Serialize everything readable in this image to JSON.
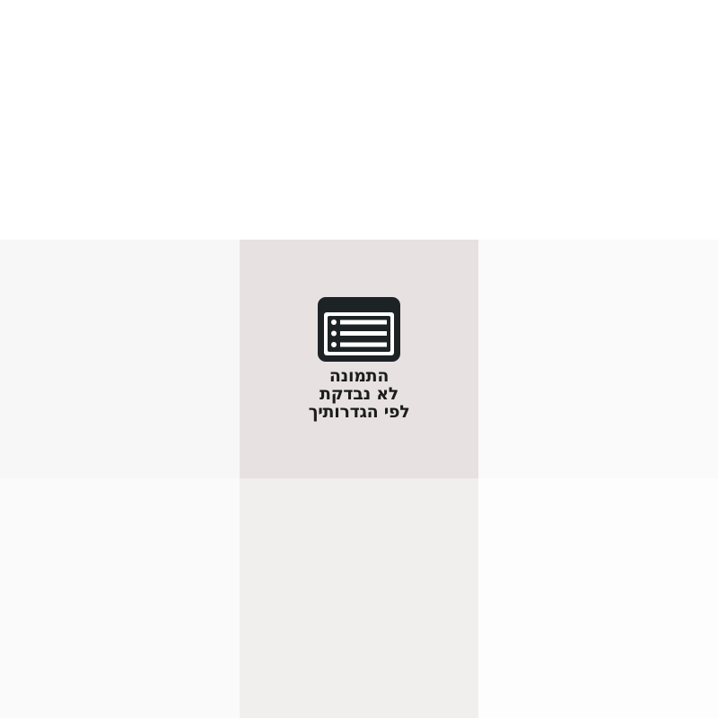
{
  "tiles": [
    {
      "color": "#ffffff"
    },
    {
      "color": "#ffffff"
    },
    {
      "color": "#ffffff"
    },
    {
      "color": "#f7f7f7"
    },
    {
      "color": "#e7e1e2"
    },
    {
      "color": "#fafafa"
    },
    {
      "color": "#fafafa"
    },
    {
      "color": "#f1efee"
    },
    {
      "color": "#fdfdfd"
    }
  ],
  "blocked_image": {
    "icon": "window-list-icon",
    "message_lines": [
      "התמונה",
      "לא נבדקת",
      "לפי הגדרותיך"
    ]
  }
}
